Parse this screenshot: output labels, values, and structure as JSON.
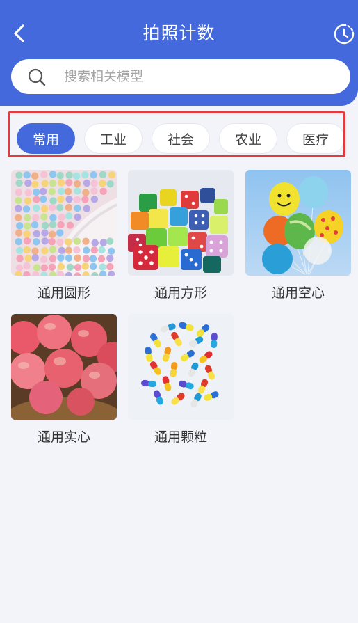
{
  "header": {
    "title": "拍照计数",
    "back_icon": "chevron-left-icon",
    "history_icon": "history-clock-icon",
    "background_color": "#4369dd"
  },
  "search": {
    "placeholder": "搜索相关模型",
    "value": ""
  },
  "tabs": [
    {
      "label": "常用",
      "active": true
    },
    {
      "label": "工业",
      "active": false
    },
    {
      "label": "社会",
      "active": false
    },
    {
      "label": "农业",
      "active": false
    },
    {
      "label": "医疗",
      "active": false
    }
  ],
  "models": [
    {
      "label": "通用圆形",
      "image": "beads-photo"
    },
    {
      "label": "通用方形",
      "image": "dice-photo"
    },
    {
      "label": "通用空心",
      "image": "balloons-photo"
    },
    {
      "label": "通用实心",
      "image": "apples-photo"
    },
    {
      "label": "通用颗粒",
      "image": "capsules-photo"
    }
  ],
  "highlight_color": "#e33a3f"
}
